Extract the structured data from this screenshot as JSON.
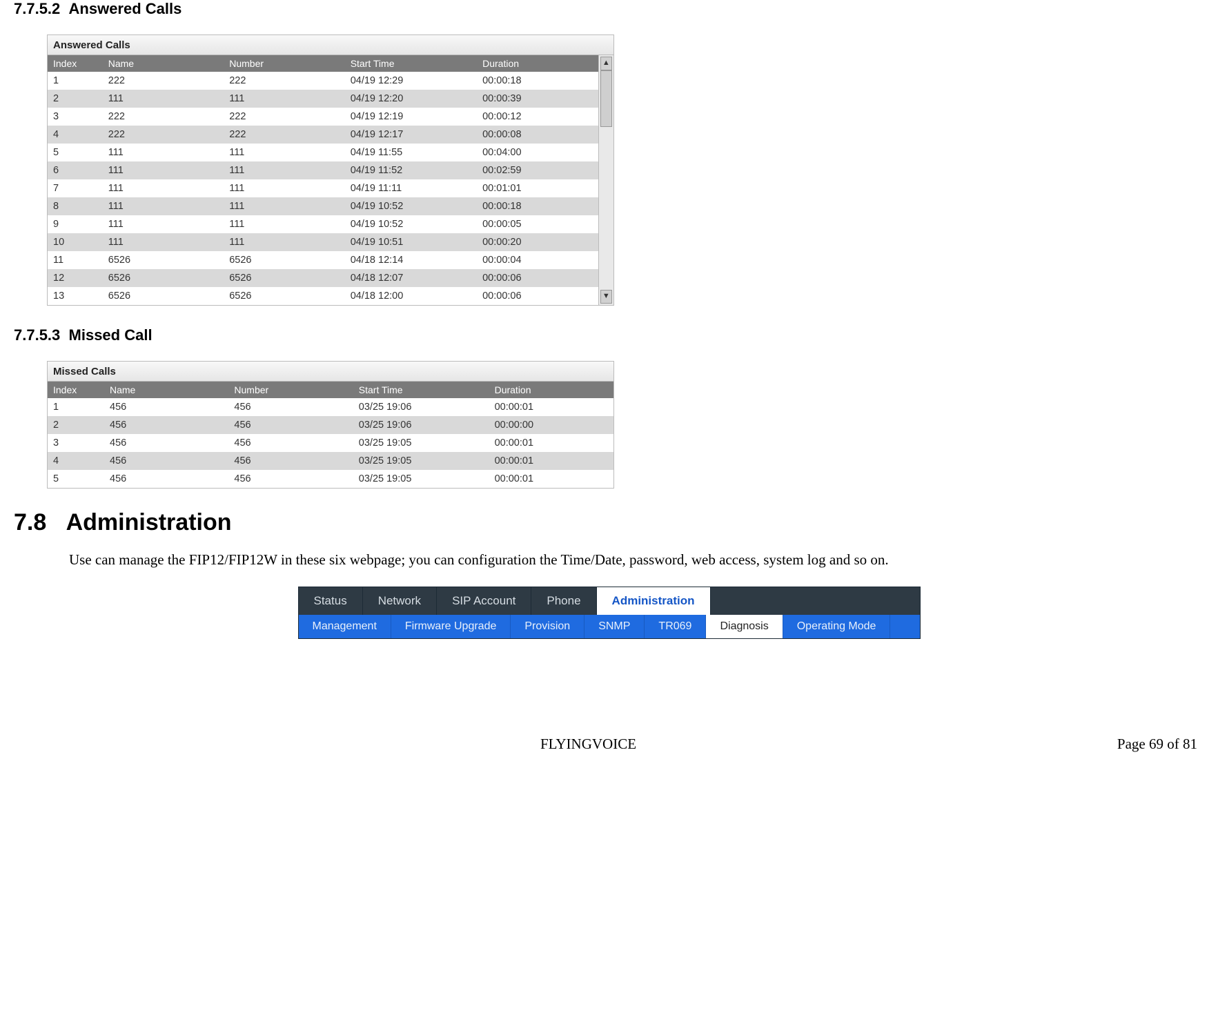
{
  "section1": {
    "number": "7.7.5.2",
    "title": "Answered Calls",
    "panel_title": "Answered Calls",
    "columns": [
      "Index",
      "Name",
      "Number",
      "Start Time",
      "Duration"
    ],
    "rows": [
      {
        "index": "1",
        "name": "222",
        "number": "222",
        "start": "04/19 12:29",
        "dur": "00:00:18"
      },
      {
        "index": "2",
        "name": "111",
        "number": "111",
        "start": "04/19 12:20",
        "dur": "00:00:39"
      },
      {
        "index": "3",
        "name": "222",
        "number": "222",
        "start": "04/19 12:19",
        "dur": "00:00:12"
      },
      {
        "index": "4",
        "name": "222",
        "number": "222",
        "start": "04/19 12:17",
        "dur": "00:00:08"
      },
      {
        "index": "5",
        "name": "111",
        "number": "111",
        "start": "04/19 11:55",
        "dur": "00:04:00"
      },
      {
        "index": "6",
        "name": "111",
        "number": "111",
        "start": "04/19 11:52",
        "dur": "00:02:59"
      },
      {
        "index": "7",
        "name": "111",
        "number": "111",
        "start": "04/19 11:11",
        "dur": "00:01:01"
      },
      {
        "index": "8",
        "name": "111",
        "number": "111",
        "start": "04/19 10:52",
        "dur": "00:00:18"
      },
      {
        "index": "9",
        "name": "111",
        "number": "111",
        "start": "04/19 10:52",
        "dur": "00:00:05"
      },
      {
        "index": "10",
        "name": "111",
        "number": "111",
        "start": "04/19 10:51",
        "dur": "00:00:20"
      },
      {
        "index": "11",
        "name": "6526",
        "number": "6526",
        "start": "04/18 12:14",
        "dur": "00:00:04"
      },
      {
        "index": "12",
        "name": "6526",
        "number": "6526",
        "start": "04/18 12:07",
        "dur": "00:00:06"
      },
      {
        "index": "13",
        "name": "6526",
        "number": "6526",
        "start": "04/18 12:00",
        "dur": "00:00:06"
      }
    ]
  },
  "section2": {
    "number": "7.7.5.3",
    "title": "Missed Call",
    "panel_title": "Missed Calls",
    "columns": [
      "Index",
      "Name",
      "Number",
      "Start Time",
      "Duration"
    ],
    "rows": [
      {
        "index": "1",
        "name": "456",
        "number": "456",
        "start": "03/25 19:06",
        "dur": "00:00:01"
      },
      {
        "index": "2",
        "name": "456",
        "number": "456",
        "start": "03/25 19:06",
        "dur": "00:00:00"
      },
      {
        "index": "3",
        "name": "456",
        "number": "456",
        "start": "03/25 19:05",
        "dur": "00:00:01"
      },
      {
        "index": "4",
        "name": "456",
        "number": "456",
        "start": "03/25 19:05",
        "dur": "00:00:01"
      },
      {
        "index": "5",
        "name": "456",
        "number": "456",
        "start": "03/25 19:05",
        "dur": "00:00:01"
      }
    ]
  },
  "section3": {
    "number": "7.8",
    "title": "Administration",
    "paragraph": "Use can manage the FIP12/FIP12W in these six webpage; you can configuration the Time/Date, password, web access, system log and so on."
  },
  "nav": {
    "top_tabs": [
      "Status",
      "Network",
      "SIP Account",
      "Phone",
      "Administration"
    ],
    "top_active_index": 4,
    "sub_tabs": [
      "Management",
      "Firmware Upgrade",
      "Provision",
      "SNMP",
      "TR069",
      "Diagnosis",
      "Operating Mode"
    ],
    "sub_active_index": 5
  },
  "footer": {
    "brand": "FLYINGVOICE",
    "page_text": "Page 69 of 81"
  },
  "scroll": {
    "up": "▲",
    "down": "▼"
  }
}
